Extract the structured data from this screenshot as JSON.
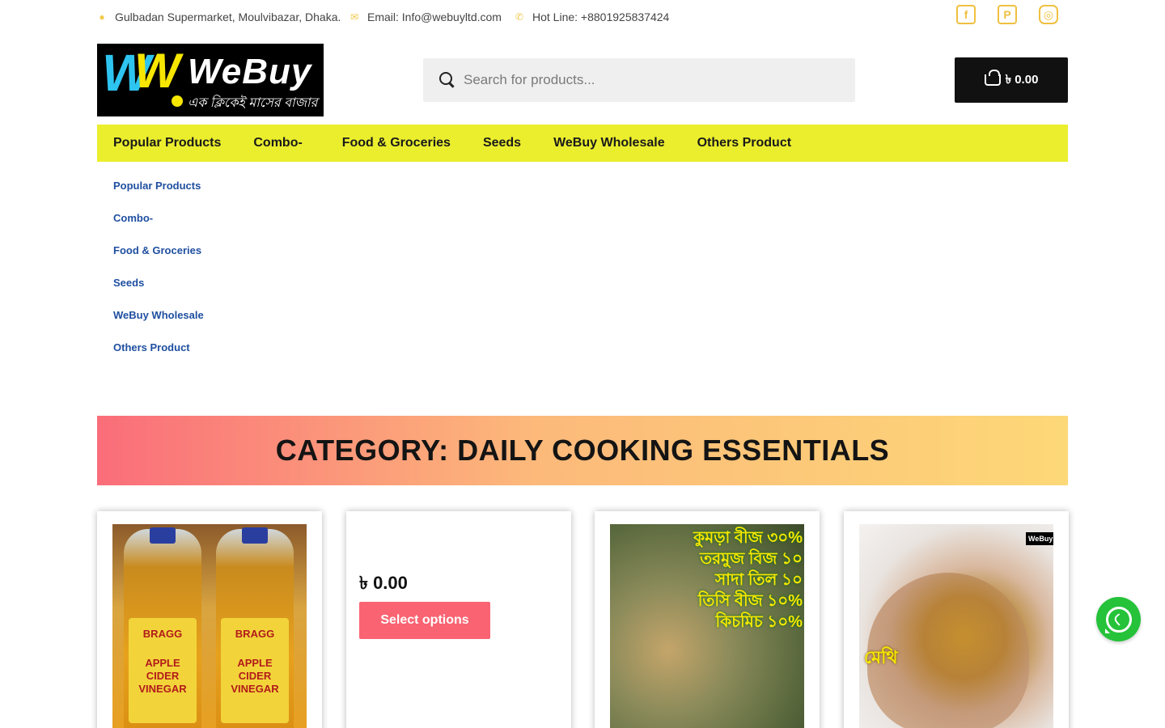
{
  "topbar": {
    "address": "Gulbadan Supermarket, Moulvibazar, Dhaka.",
    "email": "Email: Info@webuyltd.com",
    "hotline": "Hot Line: +8801925837424",
    "social": [
      {
        "icon": "facebook-icon",
        "glyph": "f"
      },
      {
        "icon": "pinterest-icon",
        "glyph": "P"
      },
      {
        "icon": "instagram-icon",
        "glyph": "◎"
      }
    ]
  },
  "logo": {
    "brand": "WeBuy",
    "tagline": "এক ক্লিকেই মাসের বাজার"
  },
  "search": {
    "placeholder": "Search for products..."
  },
  "cart": {
    "total": "৳ 0.00"
  },
  "nav": {
    "items": [
      "Popular Products",
      "Combo- 󠁯󠁯󠁯󠁯󠁯 󠁯󠁯󠁯󠁯󠁯",
      "Food & Groceries",
      "Seeds",
      "WeBuy Wholesale",
      "Others Product"
    ]
  },
  "submenu": {
    "items": [
      "Popular Products",
      "Combo- 󠁯󠁯󠁯󠁯󠁯 󠁯󠁯󠁯󠁯󠁯",
      "Food & Groceries",
      "Seeds",
      "WeBuy Wholesale",
      "Others Product"
    ]
  },
  "banner": {
    "title": "CATEGORY: DAILY COOKING ESSENTIALS"
  },
  "products": {
    "p1": {
      "label1": "BRAGG",
      "label2": "APPLE CIDER VINEGAR"
    },
    "p2": {
      "title": "󠁯󠁯 󠁯󠁯󠁯󠁯󠁯󠁯",
      "price": "৳ 0.00",
      "button": "Select options"
    },
    "p3": {
      "lines": [
        "কুমড়া বীজ ৩০%",
        "তরমুজ বিজ ১০",
        "সাদা তিল ১০",
        "তিসি বীজ ১০%",
        "কিচমিচ ১০%"
      ]
    },
    "p4": {
      "word": "মেথি",
      "badge": "WeBuy"
    }
  },
  "whatsapp": {
    "icon": "whatsapp-icon"
  },
  "colors": {
    "nav_bg": "#ebee2d",
    "accent_button": "#f96372",
    "icon_gold": "#f2c94c",
    "link_blue": "#1f4fa0"
  }
}
